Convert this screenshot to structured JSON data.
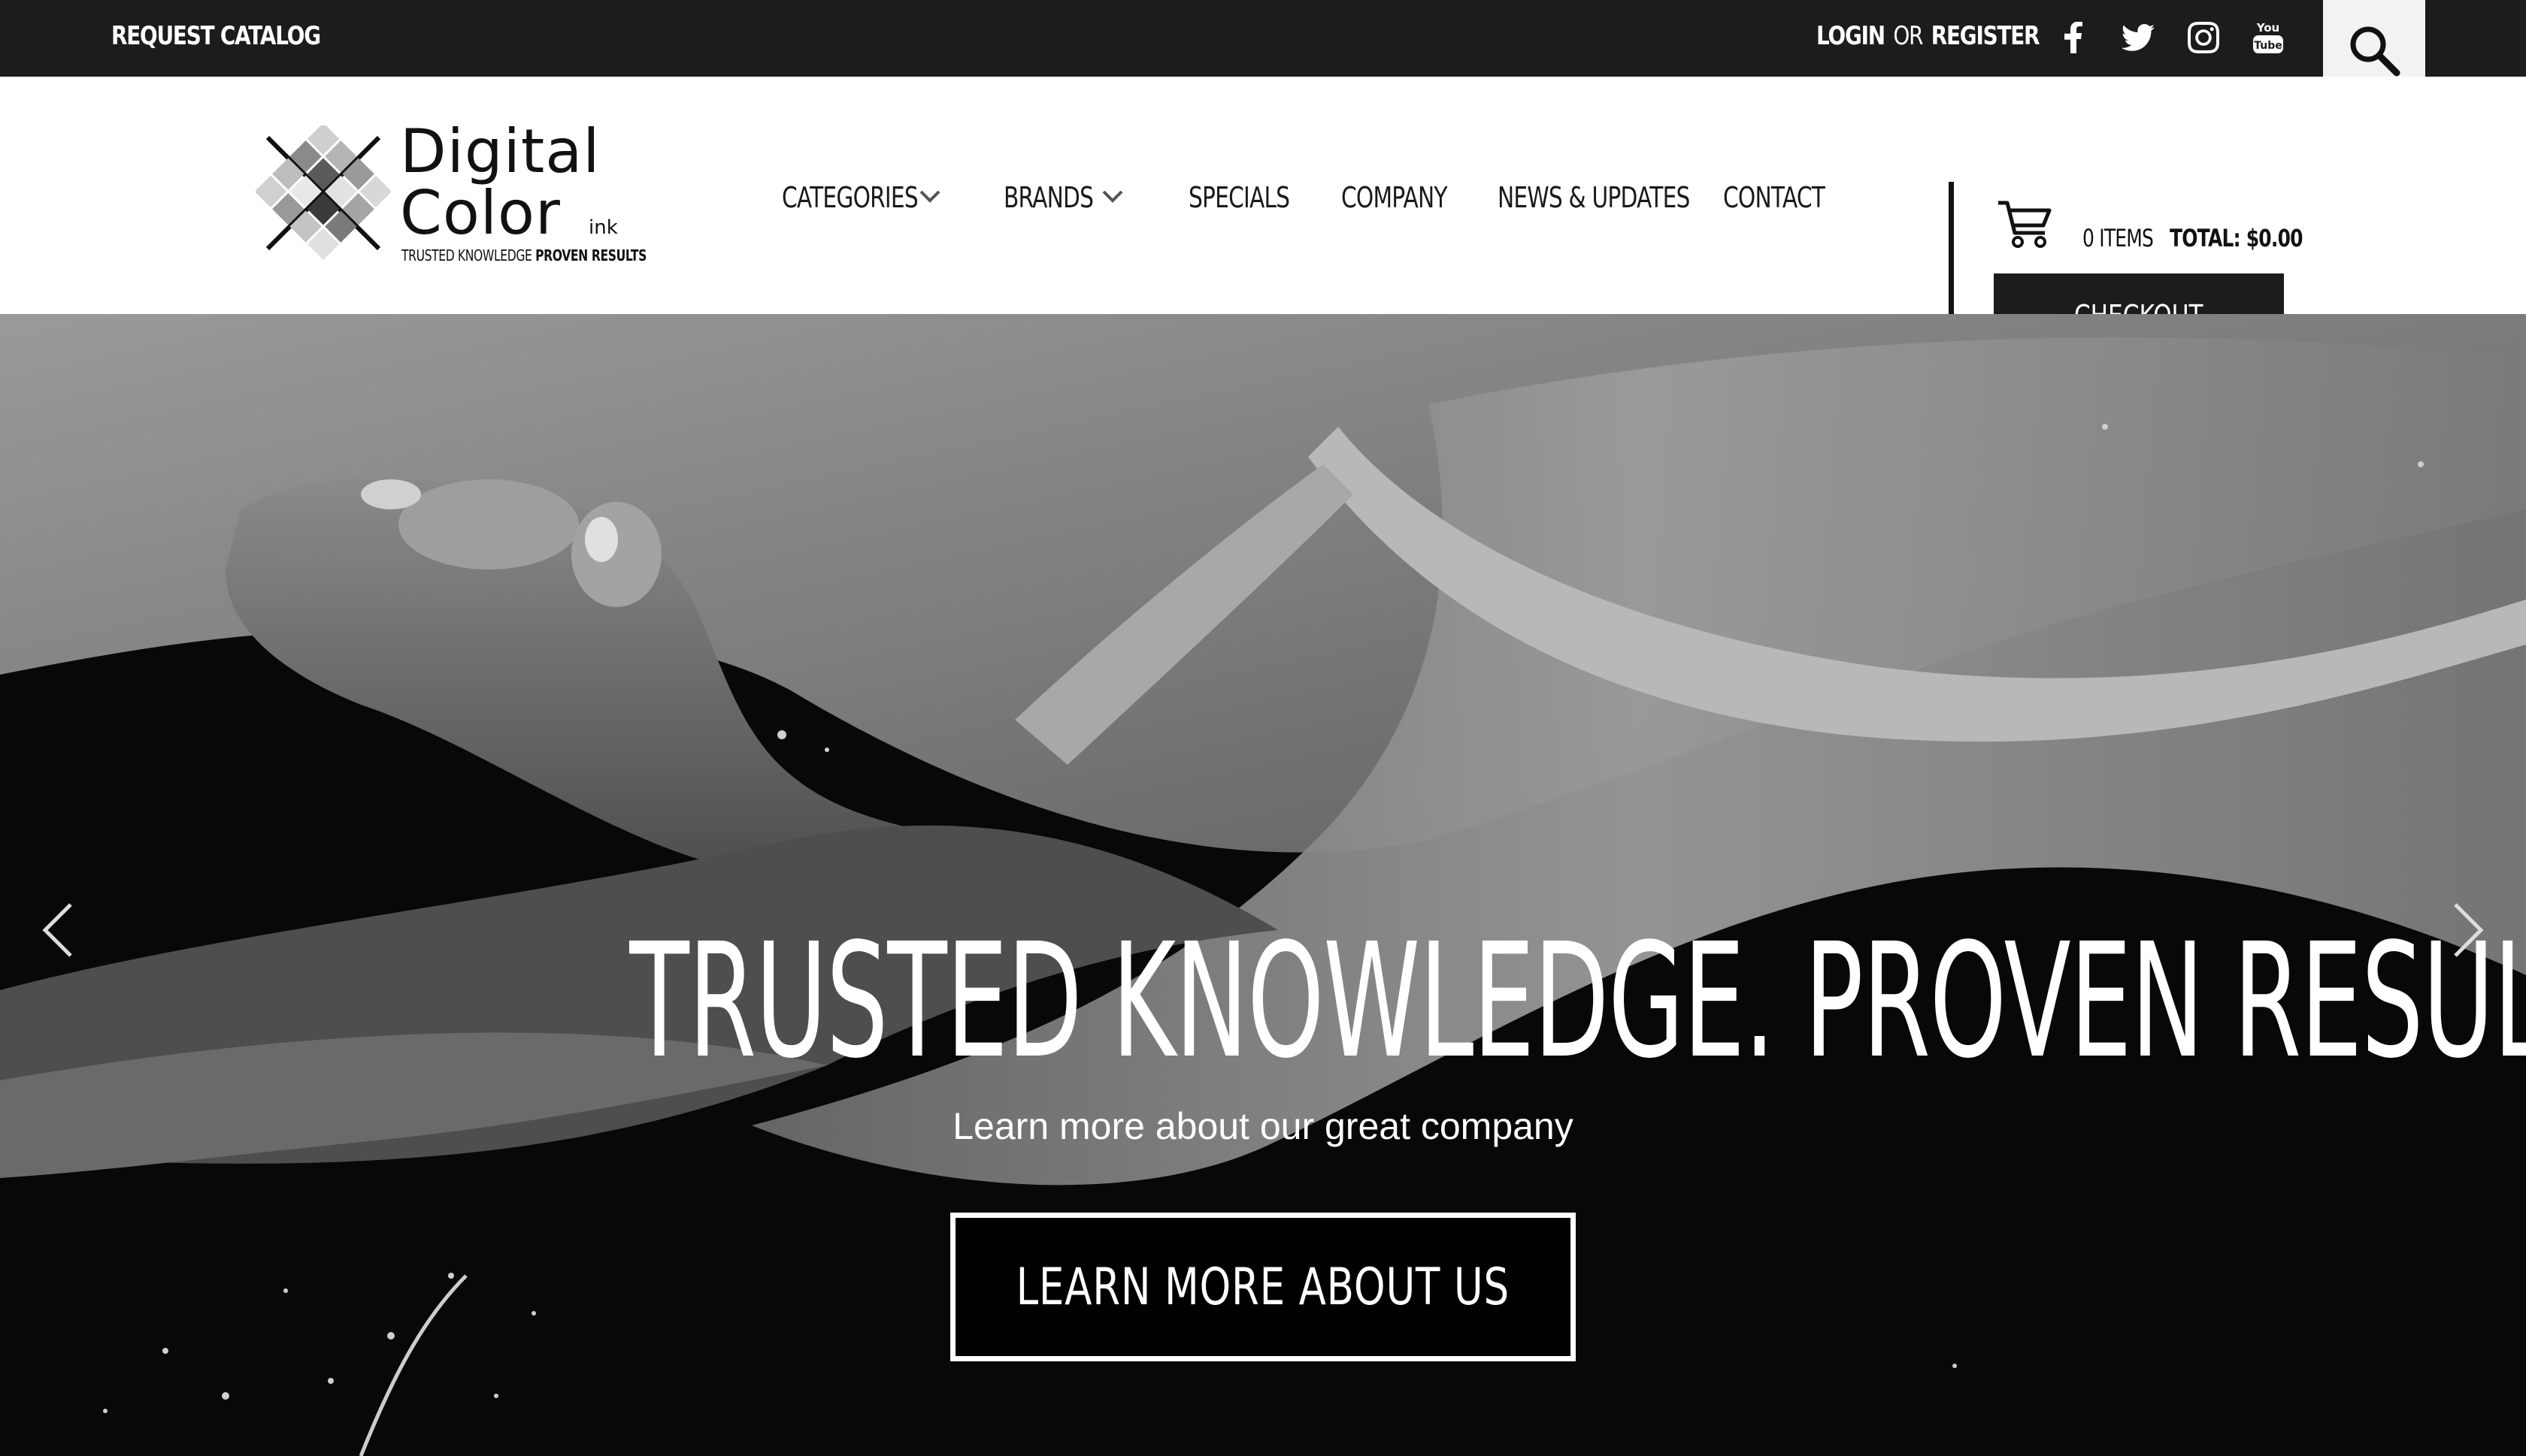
{
  "topbar": {
    "request_catalog": "REQUEST CATALOG",
    "login": "LOGIN",
    "or": "OR",
    "register": "REGISTER",
    "social_icons": [
      "facebook-icon",
      "twitter-icon",
      "instagram-icon",
      "youtube-icon"
    ],
    "youtube_you": "You",
    "youtube_tube": "Tube",
    "search_icon": "search-icon"
  },
  "logo": {
    "line1": "Digital",
    "line2": "Color",
    "ink": "ink",
    "tagline_a": "TRUSTED KNOWLEDGE",
    "tagline_b": "PROVEN RESULTS"
  },
  "nav": {
    "items": [
      {
        "label": "CATEGORIES",
        "has_dropdown": true
      },
      {
        "label": "BRANDS",
        "has_dropdown": true
      },
      {
        "label": "SPECIALS",
        "has_dropdown": false
      },
      {
        "label": "COMPANY",
        "has_dropdown": false
      },
      {
        "label": "NEWS & UPDATES",
        "has_dropdown": false
      },
      {
        "label": "CONTACT",
        "has_dropdown": false
      }
    ]
  },
  "cart": {
    "items": "0 ITEMS",
    "total": "TOTAL: $0.00",
    "checkout_label": "CHECKOUT"
  },
  "hero": {
    "title": "TRUSTED KNOWLEDGE. PROVEN RESULTS.",
    "subtitle": "Learn more about our great company",
    "button_label": "LEARN MORE ABOUT US",
    "prev_icon": "chevron-left-icon",
    "next_icon": "chevron-right-icon"
  },
  "colors": {
    "topbar_bg": "#1c1c1c",
    "button_bg": "#1c1c1c",
    "hero_bg": "#0d0d0d",
    "text_light": "#ffffff"
  }
}
